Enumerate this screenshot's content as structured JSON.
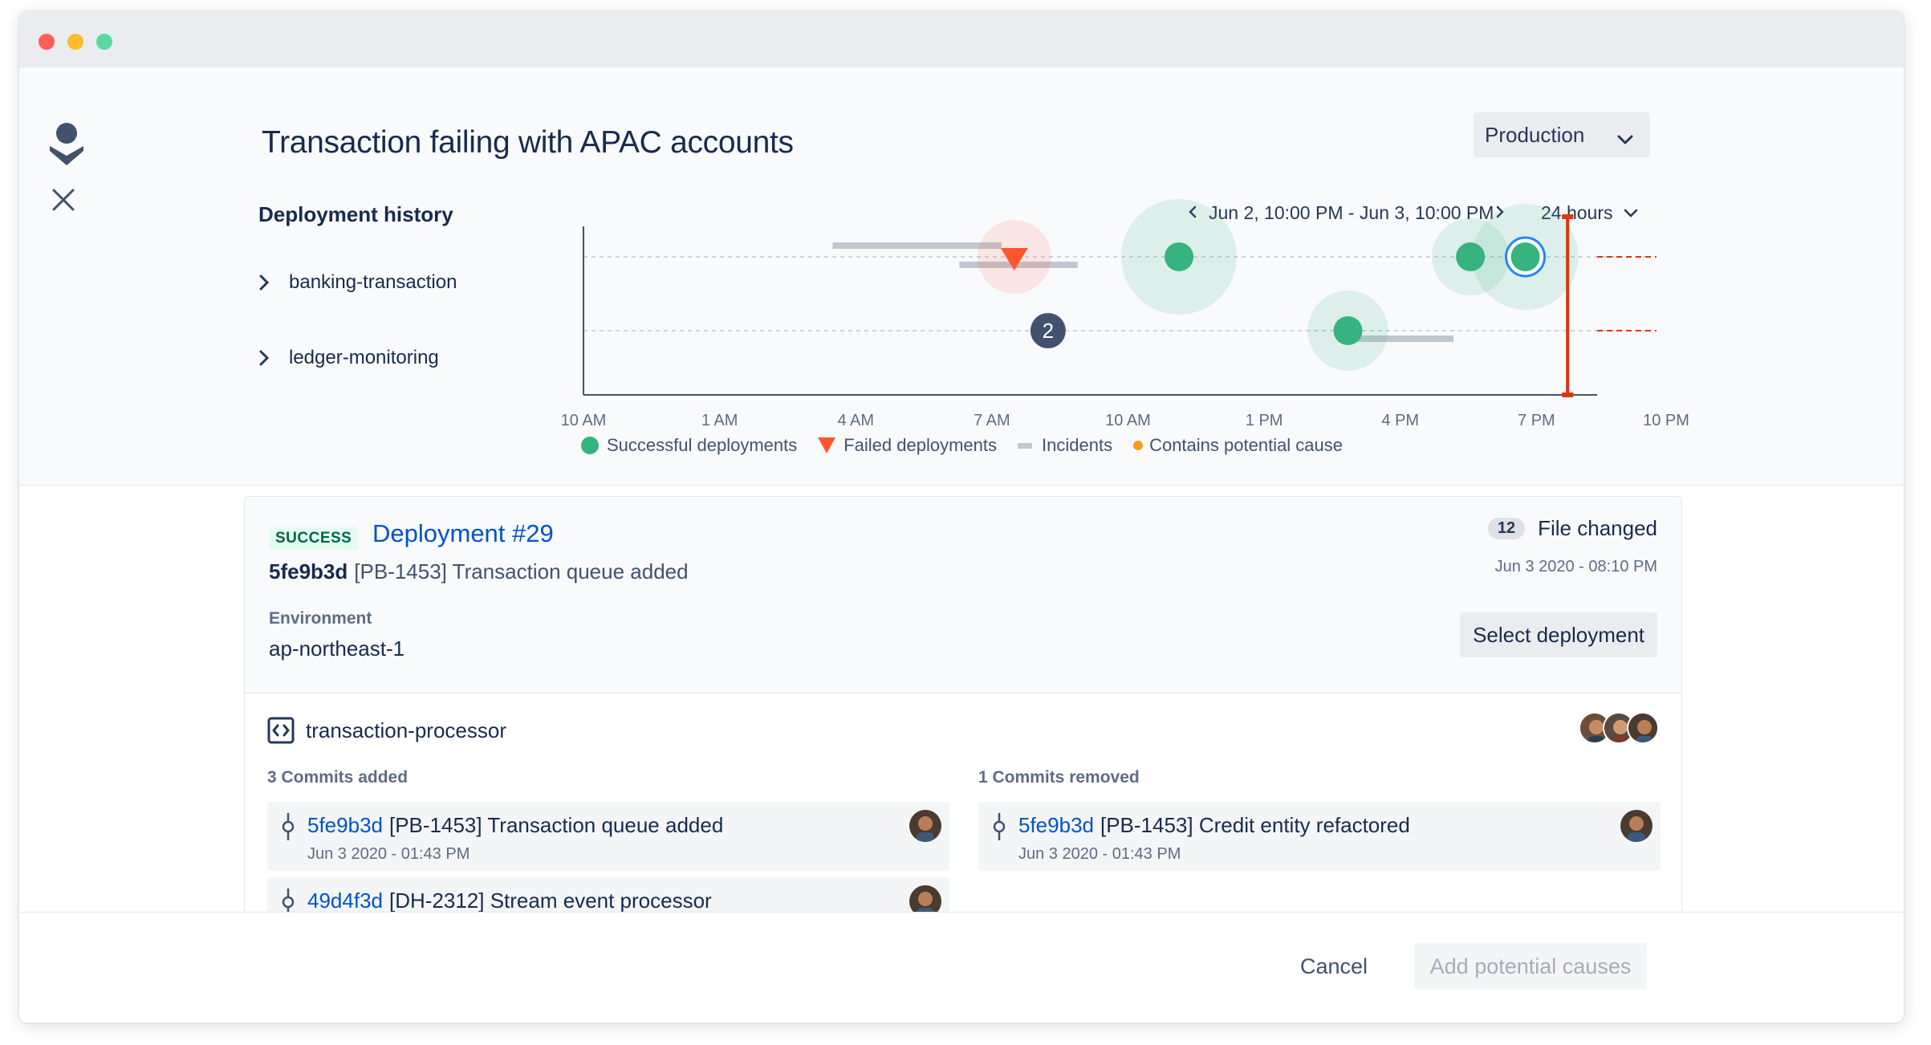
{
  "window": {
    "controls": [
      "close",
      "minimize",
      "maximize"
    ]
  },
  "sidebar": {
    "logo_icon": "opsgenie-logo-icon",
    "close_icon": "close-icon"
  },
  "header": {
    "title": "Transaction failing with APAC accounts",
    "environment": "Production"
  },
  "deployment_history": {
    "title": "Deployment history",
    "range": "Jun 2, 10:00 PM - Jun 3, 10:00 PM",
    "window": "24 hours",
    "services": [
      {
        "name": "banking-transaction"
      },
      {
        "name": "ledger-monitoring"
      }
    ],
    "legend": {
      "successful": "Successful deployments",
      "failed": "Failed deployments",
      "incidents": "Incidents",
      "potential": "Contains potential cause"
    },
    "ticks": [
      "10 AM",
      "1 AM",
      "4 AM",
      "7 AM",
      "10 AM",
      "1 PM",
      "4 PM",
      "7 PM",
      "10 PM"
    ],
    "cluster_count": "2",
    "colors": {
      "success": "#36b37e",
      "failed": "#ff5630",
      "incident": "#c1c7d0",
      "potential": "#ff991f",
      "now": "#de350b"
    }
  },
  "chart_data": {
    "type": "scatter",
    "x_ticks": [
      "10 AM",
      "1 AM",
      "4 AM",
      "7 AM",
      "10 AM",
      "1 PM",
      "4 PM",
      "7 PM",
      "10 PM"
    ],
    "rows": [
      "banking-transaction",
      "ledger-monitoring"
    ],
    "events": [
      {
        "row": "banking-transaction",
        "kind": "failed",
        "x_hours": 10.2
      },
      {
        "row": "banking-transaction",
        "kind": "success",
        "x_hours": 14.1
      },
      {
        "row": "banking-transaction",
        "kind": "success",
        "x_hours": 21.0
      },
      {
        "row": "banking-transaction",
        "kind": "success",
        "x_hours": 22.3,
        "selected": true
      },
      {
        "row": "ledger-monitoring",
        "kind": "cluster",
        "x_hours": 11.0,
        "count": 2
      },
      {
        "row": "ledger-monitoring",
        "kind": "success",
        "x_hours": 18.1
      }
    ],
    "incidents": [
      {
        "row": "banking-transaction",
        "start_hours": 5.9,
        "end_hours": 9.9
      },
      {
        "row": "banking-transaction",
        "start_hours": 8.9,
        "end_hours": 11.7
      },
      {
        "row": "ledger-monitoring",
        "start_hours": 18.0,
        "end_hours": 20.6
      }
    ],
    "now_hours": 23.3
  },
  "deployment": {
    "status": "SUCCESS",
    "title": "Deployment #29",
    "commit_hash": "5fe9b3d",
    "commit_message": "[PB-1453] Transaction queue added",
    "environment_label": "Environment",
    "environment": "ap-northeast-1",
    "files_count": "12",
    "files_label": "File changed",
    "date": "Jun 3 2020 - 08:10 PM",
    "select_label": "Select deployment"
  },
  "repo": {
    "name": "transaction-processor",
    "icon": "code-icon"
  },
  "commits_added": {
    "title": "3 Commits added",
    "items": [
      {
        "hash": "5fe9b3d",
        "message": "[PB-1453] Transaction queue added",
        "date": "Jun 3 2020 - 01:43 PM"
      },
      {
        "hash": "49d4f3d",
        "message": "[DH-2312] Stream event processor",
        "date": ""
      }
    ]
  },
  "commits_removed": {
    "title": "1 Commits removed",
    "items": [
      {
        "hash": "5fe9b3d",
        "message": "[PB-1453] Credit entity refactored",
        "date": "Jun 3 2020 - 01:43 PM"
      }
    ]
  },
  "footer": {
    "cancel": "Cancel",
    "add": "Add potential causes"
  }
}
